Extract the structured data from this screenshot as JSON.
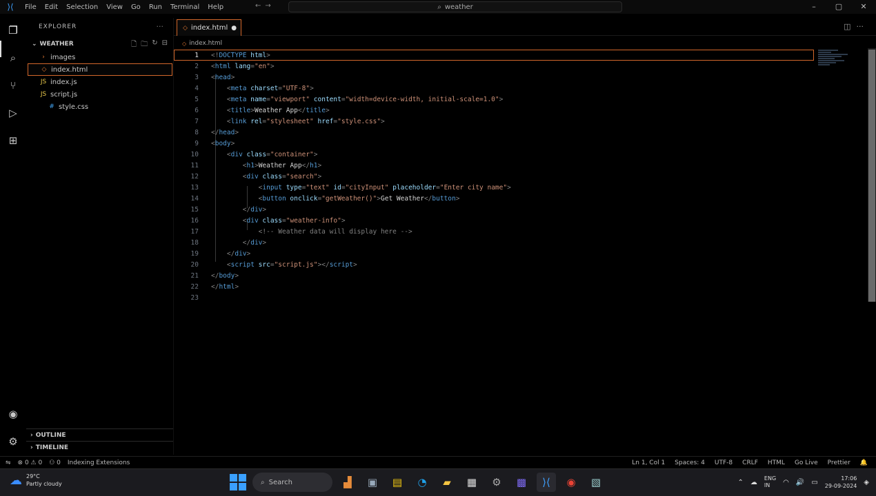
{
  "titlebar": {
    "menu": [
      "File",
      "Edit",
      "Selection",
      "View",
      "Go",
      "Run",
      "Terminal",
      "Help"
    ],
    "search": "weather"
  },
  "sidebar": {
    "header": "EXPLORER",
    "folder": "WEATHER",
    "items": [
      {
        "label": "images",
        "icon": "›"
      },
      {
        "label": "index.html",
        "icon": "◇"
      },
      {
        "label": "index.js",
        "icon": "JS"
      },
      {
        "label": "script.js",
        "icon": "JS"
      },
      {
        "label": "style.css",
        "icon": "#"
      }
    ],
    "sections": [
      "OUTLINE",
      "TIMELINE"
    ]
  },
  "tab": {
    "label": "index.html"
  },
  "breadcrumb": {
    "file": "index.html"
  },
  "editor": {
    "lines": [
      {
        "n": "1",
        "parts": [
          [
            "p",
            "<!"
          ],
          [
            "t",
            "DOCTYPE"
          ],
          [
            "a",
            " html"
          ],
          [
            "p",
            ">"
          ]
        ]
      },
      {
        "n": "2",
        "parts": [
          [
            "p",
            "<"
          ],
          [
            "t",
            "html"
          ],
          [
            "a",
            " lang"
          ],
          [
            "p",
            "="
          ],
          [
            "s",
            "\"en\""
          ],
          [
            "p",
            ">"
          ]
        ]
      },
      {
        "n": "3",
        "parts": [
          [
            "p",
            "<"
          ],
          [
            "t",
            "head"
          ],
          [
            "p",
            ">"
          ]
        ]
      },
      {
        "n": "4",
        "indent": "    ",
        "parts": [
          [
            "p",
            "<"
          ],
          [
            "t",
            "meta"
          ],
          [
            "a",
            " charset"
          ],
          [
            "p",
            "="
          ],
          [
            "s",
            "\"UTF-8\""
          ],
          [
            "p",
            ">"
          ]
        ]
      },
      {
        "n": "5",
        "indent": "    ",
        "parts": [
          [
            "p",
            "<"
          ],
          [
            "t",
            "meta"
          ],
          [
            "a",
            " name"
          ],
          [
            "p",
            "="
          ],
          [
            "s",
            "\"viewport\""
          ],
          [
            "a",
            " content"
          ],
          [
            "p",
            "="
          ],
          [
            "s",
            "\"width=device-width, initial-scale=1.0\""
          ],
          [
            "p",
            ">"
          ]
        ]
      },
      {
        "n": "6",
        "indent": "    ",
        "parts": [
          [
            "p",
            "<"
          ],
          [
            "t",
            "title"
          ],
          [
            "p",
            ">"
          ],
          [
            "x",
            "Weather App"
          ],
          [
            "p",
            "</"
          ],
          [
            "t",
            "title"
          ],
          [
            "p",
            ">"
          ]
        ]
      },
      {
        "n": "7",
        "indent": "    ",
        "parts": [
          [
            "p",
            "<"
          ],
          [
            "t",
            "link"
          ],
          [
            "a",
            " rel"
          ],
          [
            "p",
            "="
          ],
          [
            "s",
            "\"stylesheet\""
          ],
          [
            "a",
            " href"
          ],
          [
            "p",
            "="
          ],
          [
            "s",
            "\"style.css\""
          ],
          [
            "p",
            ">"
          ]
        ]
      },
      {
        "n": "8",
        "parts": [
          [
            "p",
            "</"
          ],
          [
            "t",
            "head"
          ],
          [
            "p",
            ">"
          ]
        ]
      },
      {
        "n": "9",
        "parts": [
          [
            "p",
            "<"
          ],
          [
            "t",
            "body"
          ],
          [
            "p",
            ">"
          ]
        ]
      },
      {
        "n": "10",
        "indent": "    ",
        "parts": [
          [
            "p",
            "<"
          ],
          [
            "t",
            "div"
          ],
          [
            "a",
            " class"
          ],
          [
            "p",
            "="
          ],
          [
            "s",
            "\"container\""
          ],
          [
            "p",
            ">"
          ]
        ]
      },
      {
        "n": "11",
        "indent": "        ",
        "parts": [
          [
            "p",
            "<"
          ],
          [
            "t",
            "h1"
          ],
          [
            "p",
            ">"
          ],
          [
            "x",
            "Weather App"
          ],
          [
            "p",
            "</"
          ],
          [
            "t",
            "h1"
          ],
          [
            "p",
            ">"
          ]
        ]
      },
      {
        "n": "12",
        "indent": "        ",
        "parts": [
          [
            "p",
            "<"
          ],
          [
            "t",
            "div"
          ],
          [
            "a",
            " class"
          ],
          [
            "p",
            "="
          ],
          [
            "s",
            "\"search\""
          ],
          [
            "p",
            ">"
          ]
        ]
      },
      {
        "n": "13",
        "indent": "            ",
        "parts": [
          [
            "p",
            "<"
          ],
          [
            "t",
            "input"
          ],
          [
            "a",
            " type"
          ],
          [
            "p",
            "="
          ],
          [
            "s",
            "\"text\""
          ],
          [
            "a",
            " id"
          ],
          [
            "p",
            "="
          ],
          [
            "s",
            "\"cityInput\""
          ],
          [
            "a",
            " placeholder"
          ],
          [
            "p",
            "="
          ],
          [
            "s",
            "\"Enter city name\""
          ],
          [
            "p",
            ">"
          ]
        ]
      },
      {
        "n": "14",
        "indent": "            ",
        "parts": [
          [
            "p",
            "<"
          ],
          [
            "t",
            "button"
          ],
          [
            "a",
            " onclick"
          ],
          [
            "p",
            "="
          ],
          [
            "s",
            "\"getWeather()\""
          ],
          [
            "p",
            ">"
          ],
          [
            "x",
            "Get Weather"
          ],
          [
            "p",
            "</"
          ],
          [
            "t",
            "button"
          ],
          [
            "p",
            ">"
          ]
        ]
      },
      {
        "n": "15",
        "indent": "        ",
        "parts": [
          [
            "p",
            "</"
          ],
          [
            "t",
            "div"
          ],
          [
            "p",
            ">"
          ]
        ]
      },
      {
        "n": "16",
        "indent": "        ",
        "parts": [
          [
            "p",
            "<"
          ],
          [
            "t",
            "div"
          ],
          [
            "a",
            " class"
          ],
          [
            "p",
            "="
          ],
          [
            "s",
            "\"weather-info\""
          ],
          [
            "p",
            ">"
          ]
        ]
      },
      {
        "n": "17",
        "indent": "            ",
        "parts": [
          [
            "p",
            "<!-- "
          ],
          [
            "p",
            "Weather data will display here "
          ],
          [
            "p",
            "-->"
          ]
        ]
      },
      {
        "n": "18",
        "indent": "        ",
        "parts": [
          [
            "p",
            "</"
          ],
          [
            "t",
            "div"
          ],
          [
            "p",
            ">"
          ]
        ]
      },
      {
        "n": "19",
        "indent": "    ",
        "parts": [
          [
            "p",
            "</"
          ],
          [
            "t",
            "div"
          ],
          [
            "p",
            ">"
          ]
        ]
      },
      {
        "n": "20",
        "indent": "    ",
        "parts": [
          [
            "p",
            "<"
          ],
          [
            "t",
            "script"
          ],
          [
            "a",
            " src"
          ],
          [
            "p",
            "="
          ],
          [
            "s",
            "\"script.js\""
          ],
          [
            "p",
            ">"
          ],
          [
            "p",
            "</"
          ],
          [
            "t",
            "script"
          ],
          [
            "p",
            ">"
          ]
        ]
      },
      {
        "n": "21",
        "parts": [
          [
            "p",
            "</"
          ],
          [
            "t",
            "body"
          ],
          [
            "p",
            ">"
          ]
        ]
      },
      {
        "n": "22",
        "parts": [
          [
            "p",
            "</"
          ],
          [
            "t",
            "html"
          ],
          [
            "p",
            ">"
          ]
        ]
      },
      {
        "n": "23",
        "parts": []
      }
    ]
  },
  "statusbar": {
    "left": [
      "⊗ 0 ⚠ 0",
      "⚇ 0",
      "Indexing Extensions"
    ],
    "right": [
      "Ln 1, Col 1",
      "Spaces: 4",
      "UTF-8",
      "CRLF",
      "HTML",
      "Go Live",
      "Prettier"
    ]
  },
  "taskbar": {
    "weather_temp": "29°C",
    "weather_desc": "Partly cloudy",
    "search": "Search",
    "tray_lang": "ENG\nIN",
    "time": "17:06",
    "date": "29-09-2024"
  },
  "colors": {
    "accent": "#d4682b",
    "vscode_blue": "#3ea0ff"
  }
}
